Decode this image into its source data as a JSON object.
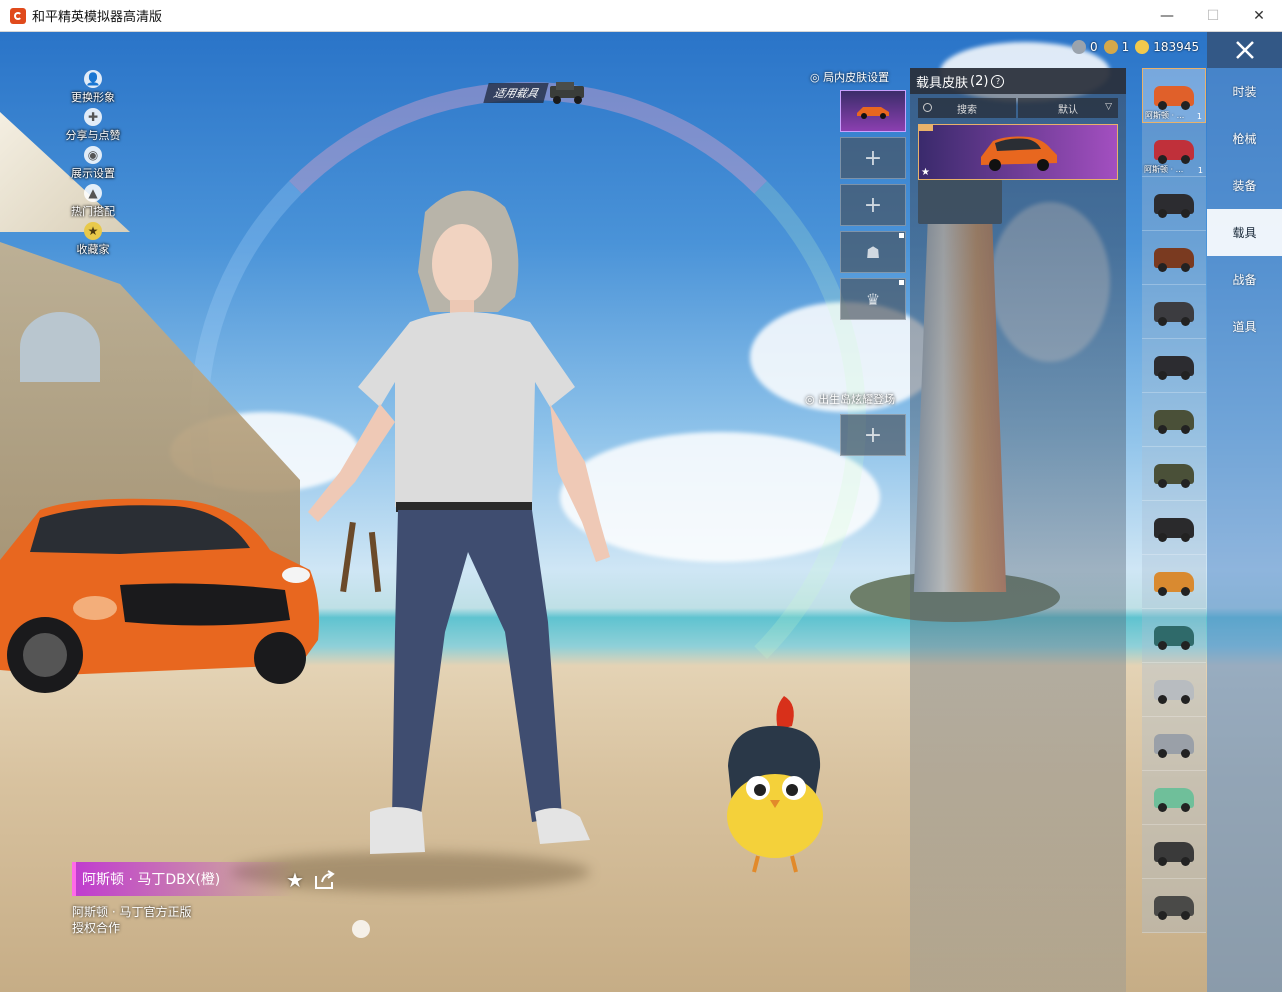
{
  "window": {
    "title": "和平精英模拟器高清版",
    "buttons": {
      "minimize": "—",
      "maximize": "☐",
      "close": "✕"
    }
  },
  "left_menu": [
    {
      "label": "更换形象",
      "icon": "person-icon"
    },
    {
      "label": "分享与点赞",
      "icon": "share-icon"
    },
    {
      "label": "展示设置",
      "icon": "eye-icon"
    },
    {
      "label": "热门搭配",
      "icon": "fire-icon"
    },
    {
      "label": "收藏家",
      "icon": "collector-badge-icon"
    }
  ],
  "vehicle_tag": {
    "label": "适用载具"
  },
  "currency": [
    {
      "icon": "ticket-icon",
      "value": "0",
      "color": "#9aa3ad"
    },
    {
      "icon": "coupon-icon",
      "value": "1",
      "color": "#d4a84a"
    },
    {
      "icon": "coin-icon",
      "value": "183945",
      "color": "#f2c94c"
    }
  ],
  "skin_settings": {
    "label": "局内皮肤设置",
    "slots": [
      "",
      "+",
      "+",
      "",
      ""
    ],
    "spawn_label": "出生岛炫耀登场",
    "spawn_slot": "+"
  },
  "vehicle_skin_panel": {
    "title": "载具皮肤",
    "count": "(2)",
    "search_label": "搜索",
    "sort_label": "默认"
  },
  "vehicle_list": [
    {
      "caption": "阿斯顿 · ...",
      "count": "1",
      "color": "#e0602a"
    },
    {
      "caption": "阿斯顿 · ...",
      "count": "1",
      "color": "#c0303a"
    },
    {
      "caption": "",
      "count": "",
      "color": "#2c2c30"
    },
    {
      "caption": "",
      "count": "",
      "color": "#7a3a20"
    },
    {
      "caption": "",
      "count": "",
      "color": "#3c3c40"
    },
    {
      "caption": "",
      "count": "",
      "color": "#2c2c30"
    },
    {
      "caption": "",
      "count": "",
      "color": "#4a5038"
    },
    {
      "caption": "",
      "count": "",
      "color": "#4a5038"
    },
    {
      "caption": "",
      "count": "",
      "color": "#2a2a2c"
    },
    {
      "caption": "",
      "count": "",
      "color": "#d98a30"
    },
    {
      "caption": "",
      "count": "",
      "color": "#2f6a6a"
    },
    {
      "caption": "",
      "count": "",
      "color": "#b8bcc0"
    },
    {
      "caption": "",
      "count": "",
      "color": "#9aa0a8"
    },
    {
      "caption": "",
      "count": "",
      "color": "#6fbf9a"
    },
    {
      "caption": "",
      "count": "",
      "color": "#3a3a3a"
    },
    {
      "caption": "",
      "count": "",
      "color": "#4a4a48"
    }
  ],
  "categories": [
    {
      "label": "时装",
      "active": false
    },
    {
      "label": "枪械",
      "active": false
    },
    {
      "label": "装备",
      "active": false
    },
    {
      "label": "载具",
      "active": true
    },
    {
      "label": "战备",
      "active": false
    },
    {
      "label": "道具",
      "active": false
    }
  ],
  "skin_info": {
    "name": "阿斯顿 · 马丁DBX(橙)",
    "official_line1": "阿斯顿 · 马丁官方正版",
    "official_line2": "授权合作"
  }
}
